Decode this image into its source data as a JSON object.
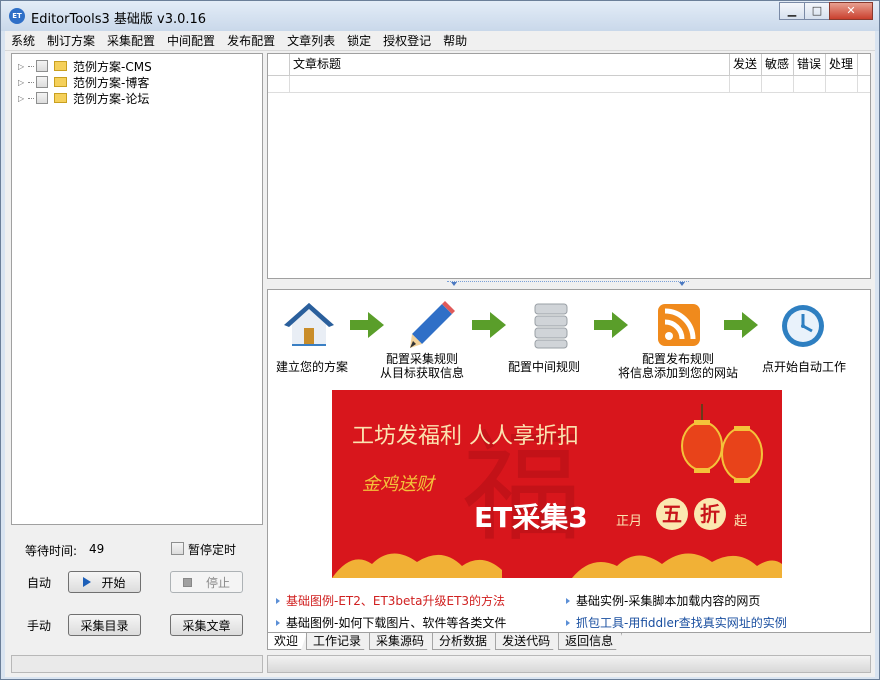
{
  "window": {
    "icon_text": "ET",
    "title": "EditorTools3 基础版 v3.0.16",
    "controls": {
      "minimize": "▁",
      "maximize": "□",
      "close": "✕"
    }
  },
  "menu": [
    "系统",
    "制订方案",
    "采集配置",
    "中间配置",
    "发布配置",
    "文章列表",
    "锁定",
    "授权登记",
    "帮助"
  ],
  "tree": {
    "items": [
      {
        "label": "范例方案-CMS"
      },
      {
        "label": "范例方案-博客"
      },
      {
        "label": "范例方案-论坛"
      }
    ]
  },
  "controls": {
    "wait_label": "等待时间:",
    "wait_value": "49",
    "pause_label": "暂停定时",
    "auto_label": "自动",
    "start_label": "开始",
    "stop_label": "停止",
    "manual_label": "手动",
    "collect_list_label": "采集目录",
    "collect_article_label": "采集文章"
  },
  "grid": {
    "columns": [
      "",
      "文章标题",
      "发送",
      "敏感",
      "错误",
      "处理"
    ]
  },
  "welcome": {
    "steps": [
      {
        "icon": "house-icon",
        "label": "建立您的方案"
      },
      {
        "icon": "pencil-icon",
        "label": "配置采集规则\n从目标获取信息"
      },
      {
        "icon": "database-icon",
        "label": "配置中间规则"
      },
      {
        "icon": "rss-icon",
        "label": "配置发布规则\n将信息添加到您的网站"
      },
      {
        "icon": "clock-icon",
        "label": "点开始自动工作"
      }
    ],
    "banner": {
      "headline": "工坊发福利 人人享折扣",
      "signature": "金鸡送财",
      "product": "ET采集3",
      "month": "正月",
      "discount_1": "五",
      "discount_2": "折",
      "suffix": "起",
      "colors": {
        "bg": "#d8161c",
        "gold": "#f4c23a"
      }
    },
    "links": [
      {
        "text": "基础图例-ET2、ET3beta升级ET3的方法",
        "color": "#d02020"
      },
      {
        "text": "基础实例-采集脚本加载内容的网页",
        "color": "#000000"
      },
      {
        "text": "基础图例-如何下载图片、软件等各类文件",
        "color": "#000000"
      },
      {
        "text": "抓包工具-用fiddler查找真实网址的实例",
        "color": "#1a4fa0"
      }
    ]
  },
  "tabs": [
    "欢迎",
    "工作记录",
    "采集源码",
    "分析数据",
    "发送代码",
    "返回信息"
  ]
}
